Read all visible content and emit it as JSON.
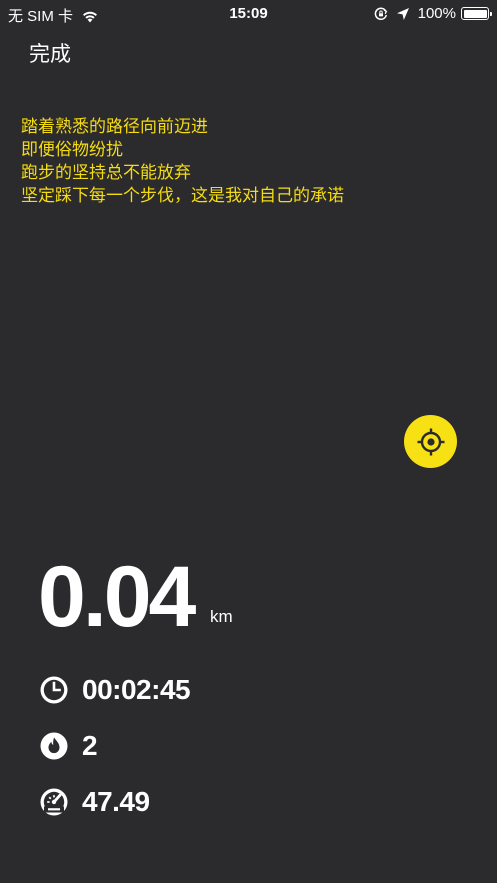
{
  "status_bar": {
    "carrier": "无 SIM 卡",
    "time": "15:09",
    "battery": "100%"
  },
  "nav": {
    "done_label": "完成"
  },
  "slogan": {
    "lines": [
      "踏着熟悉的路径向前迈进",
      "即便俗物纷扰",
      "跑步的坚持总不能放弃",
      "坚定踩下每一个步伐，这是我对自己的承诺"
    ]
  },
  "run": {
    "distance": "0.04",
    "distance_unit": "km",
    "duration": "00:02:45",
    "calories": "2",
    "speed": "47.49"
  },
  "colors": {
    "background": "#2b2a2d",
    "accent": "#f7e014",
    "slogan_text": "#f5dc12",
    "text": "#ffffff"
  },
  "icons": {
    "wifi": "wifi-icon",
    "orientation_lock": "orientation-lock-icon",
    "location": "location-arrow-icon",
    "locate": "crosshair-icon",
    "duration": "clock-icon",
    "calories": "flame-icon",
    "speed": "speedometer-icon"
  }
}
